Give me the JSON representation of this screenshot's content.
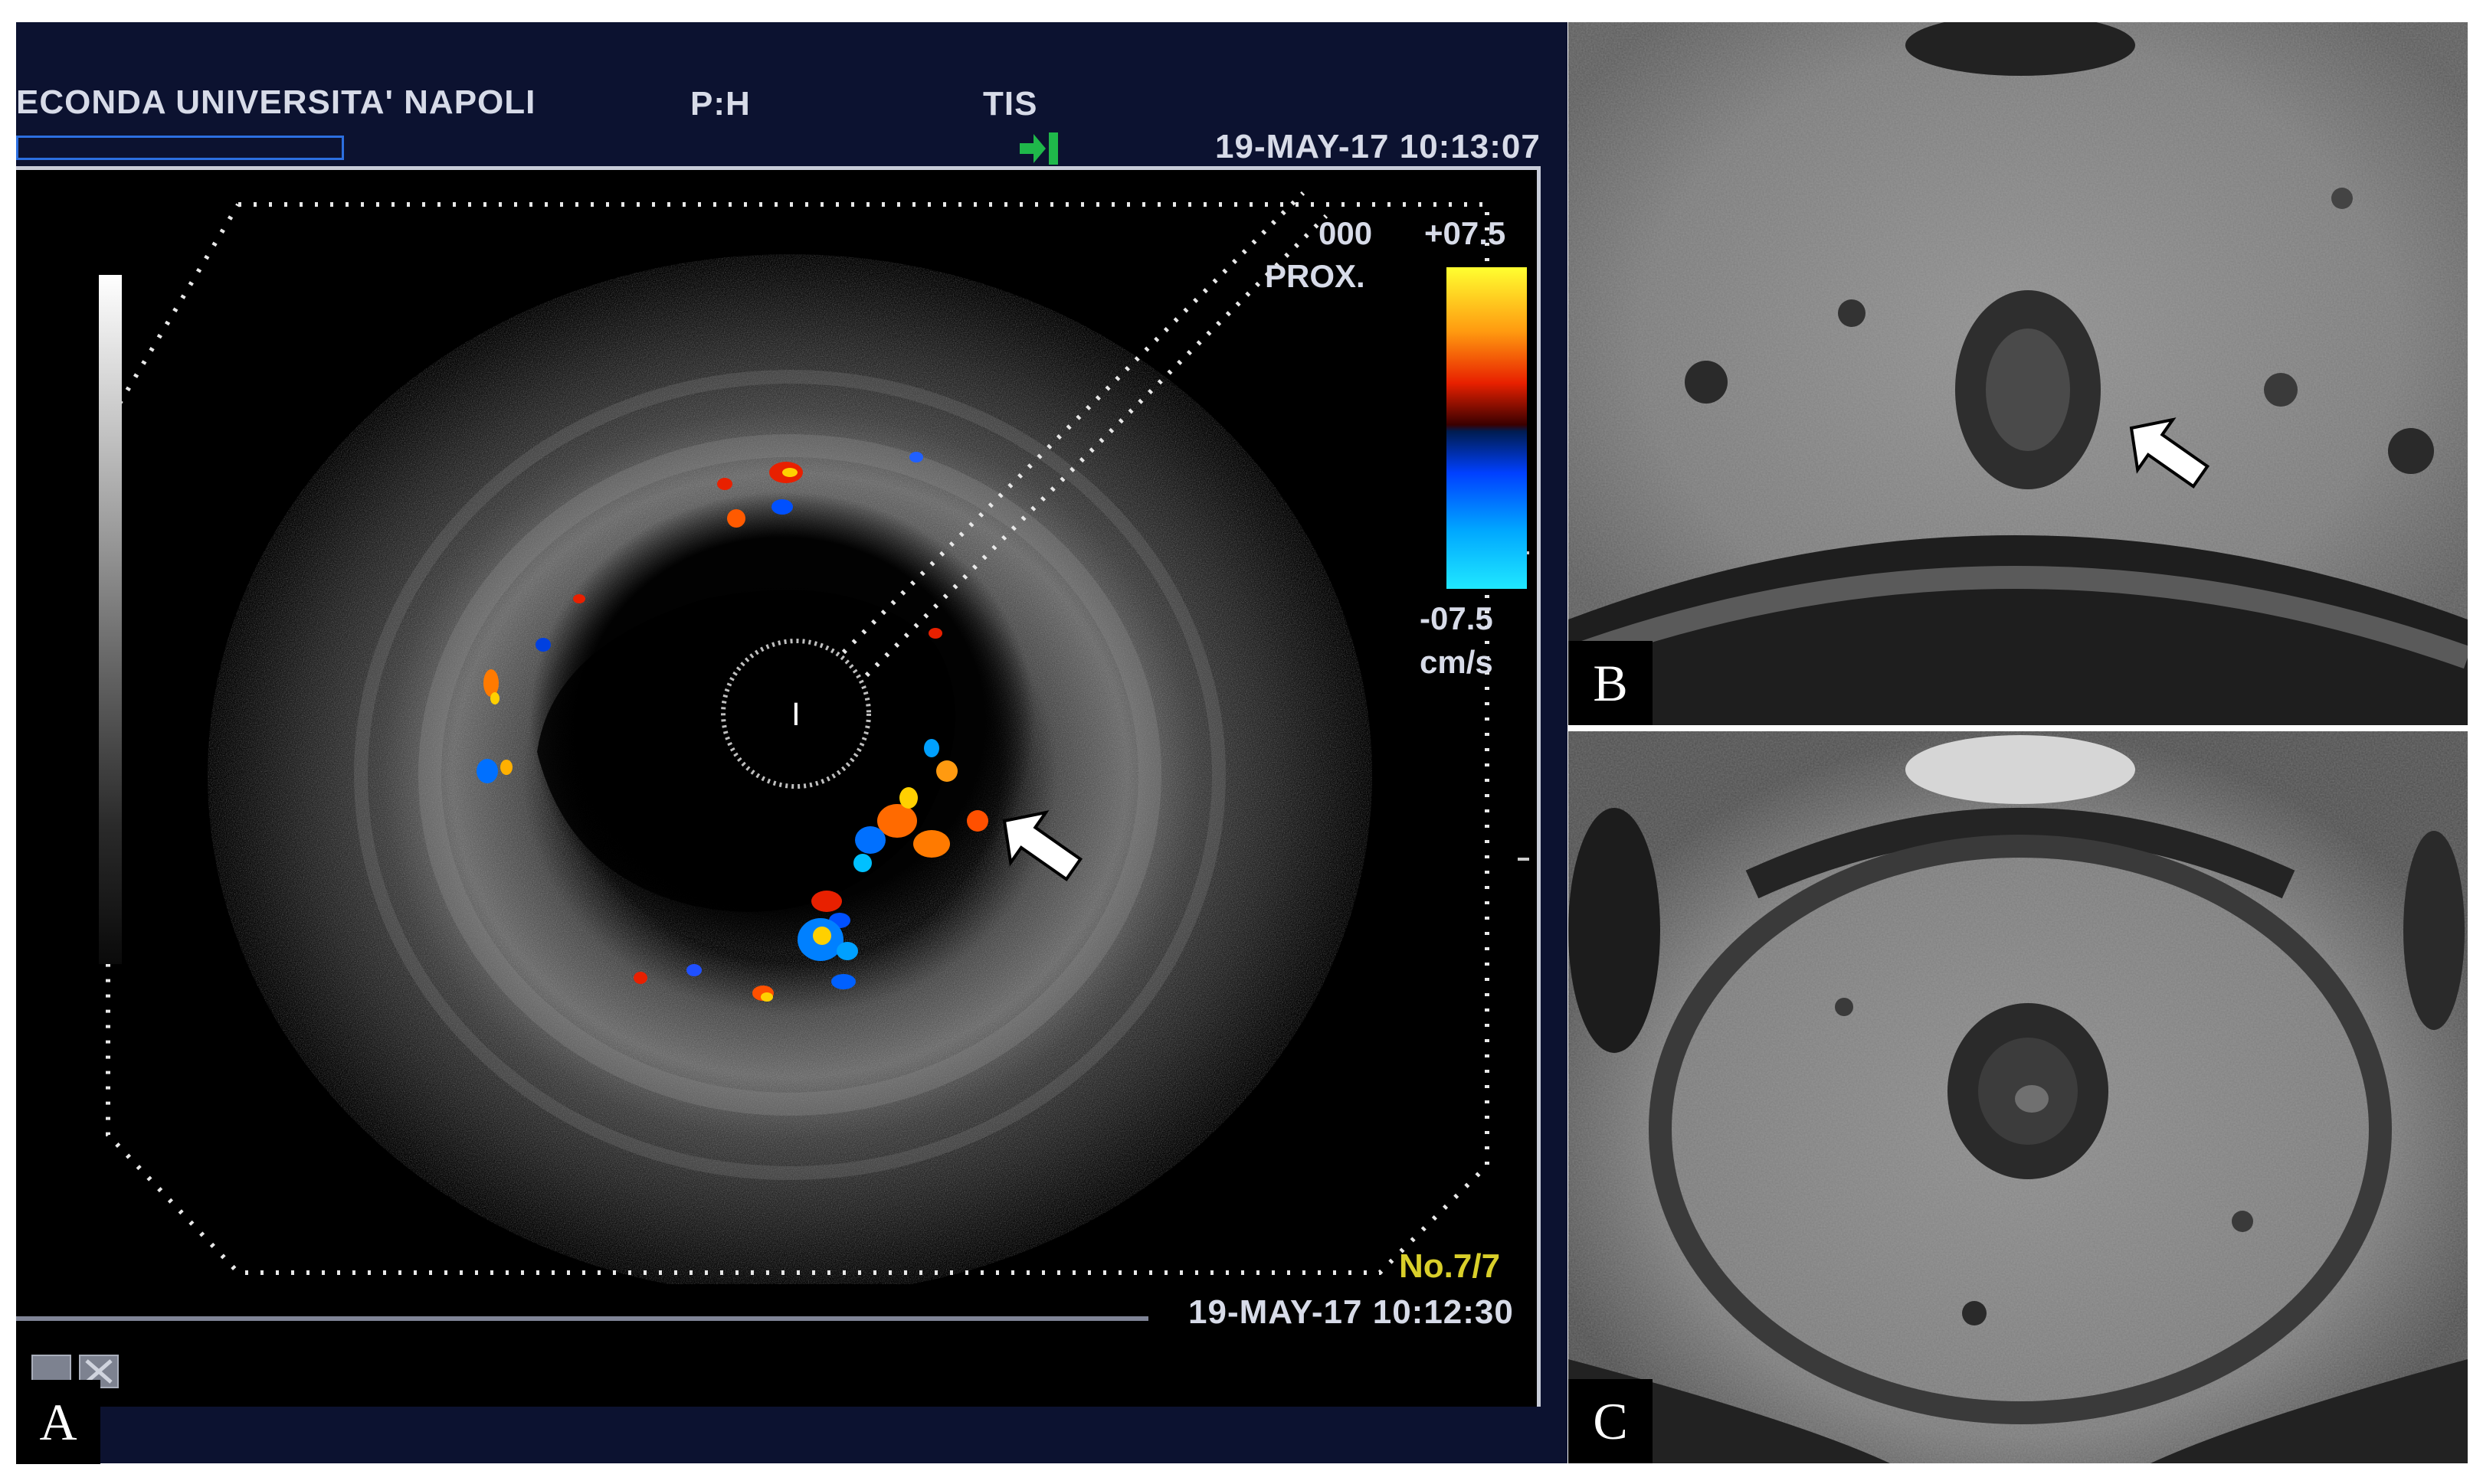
{
  "panels": {
    "a": {
      "letter": "A",
      "institution": "ECONDA UNIVERSITA' NAPOLI",
      "mode": "P:H",
      "tis": "TIS",
      "timestamp_top": "19-MAY-17 10:13:07",
      "timestamp_bottom": "19-MAY-17 10:12:30",
      "scale_max": "+07.5",
      "scale_min": "-07.5",
      "scale_unit": "cm/s",
      "probe_code": "000",
      "probe_label": "PROX.",
      "frame_counter": "No.7/7",
      "center_mark": "I"
    },
    "b": {
      "letter": "B"
    },
    "c": {
      "letter": "C"
    }
  },
  "colors": {
    "background": "#000000",
    "header_band": "#0c1230",
    "header_text": "#d7dbe8",
    "frame_counter": "#d9cf2a",
    "doppler_red": "#e82000",
    "doppler_yellow": "#ffd000",
    "doppler_blue": "#0050ff",
    "arrow": "#ffffff"
  },
  "icons": [
    "arrow-icon",
    "tis-marker-icon",
    "up-button-icon",
    "close-button-icon"
  ]
}
